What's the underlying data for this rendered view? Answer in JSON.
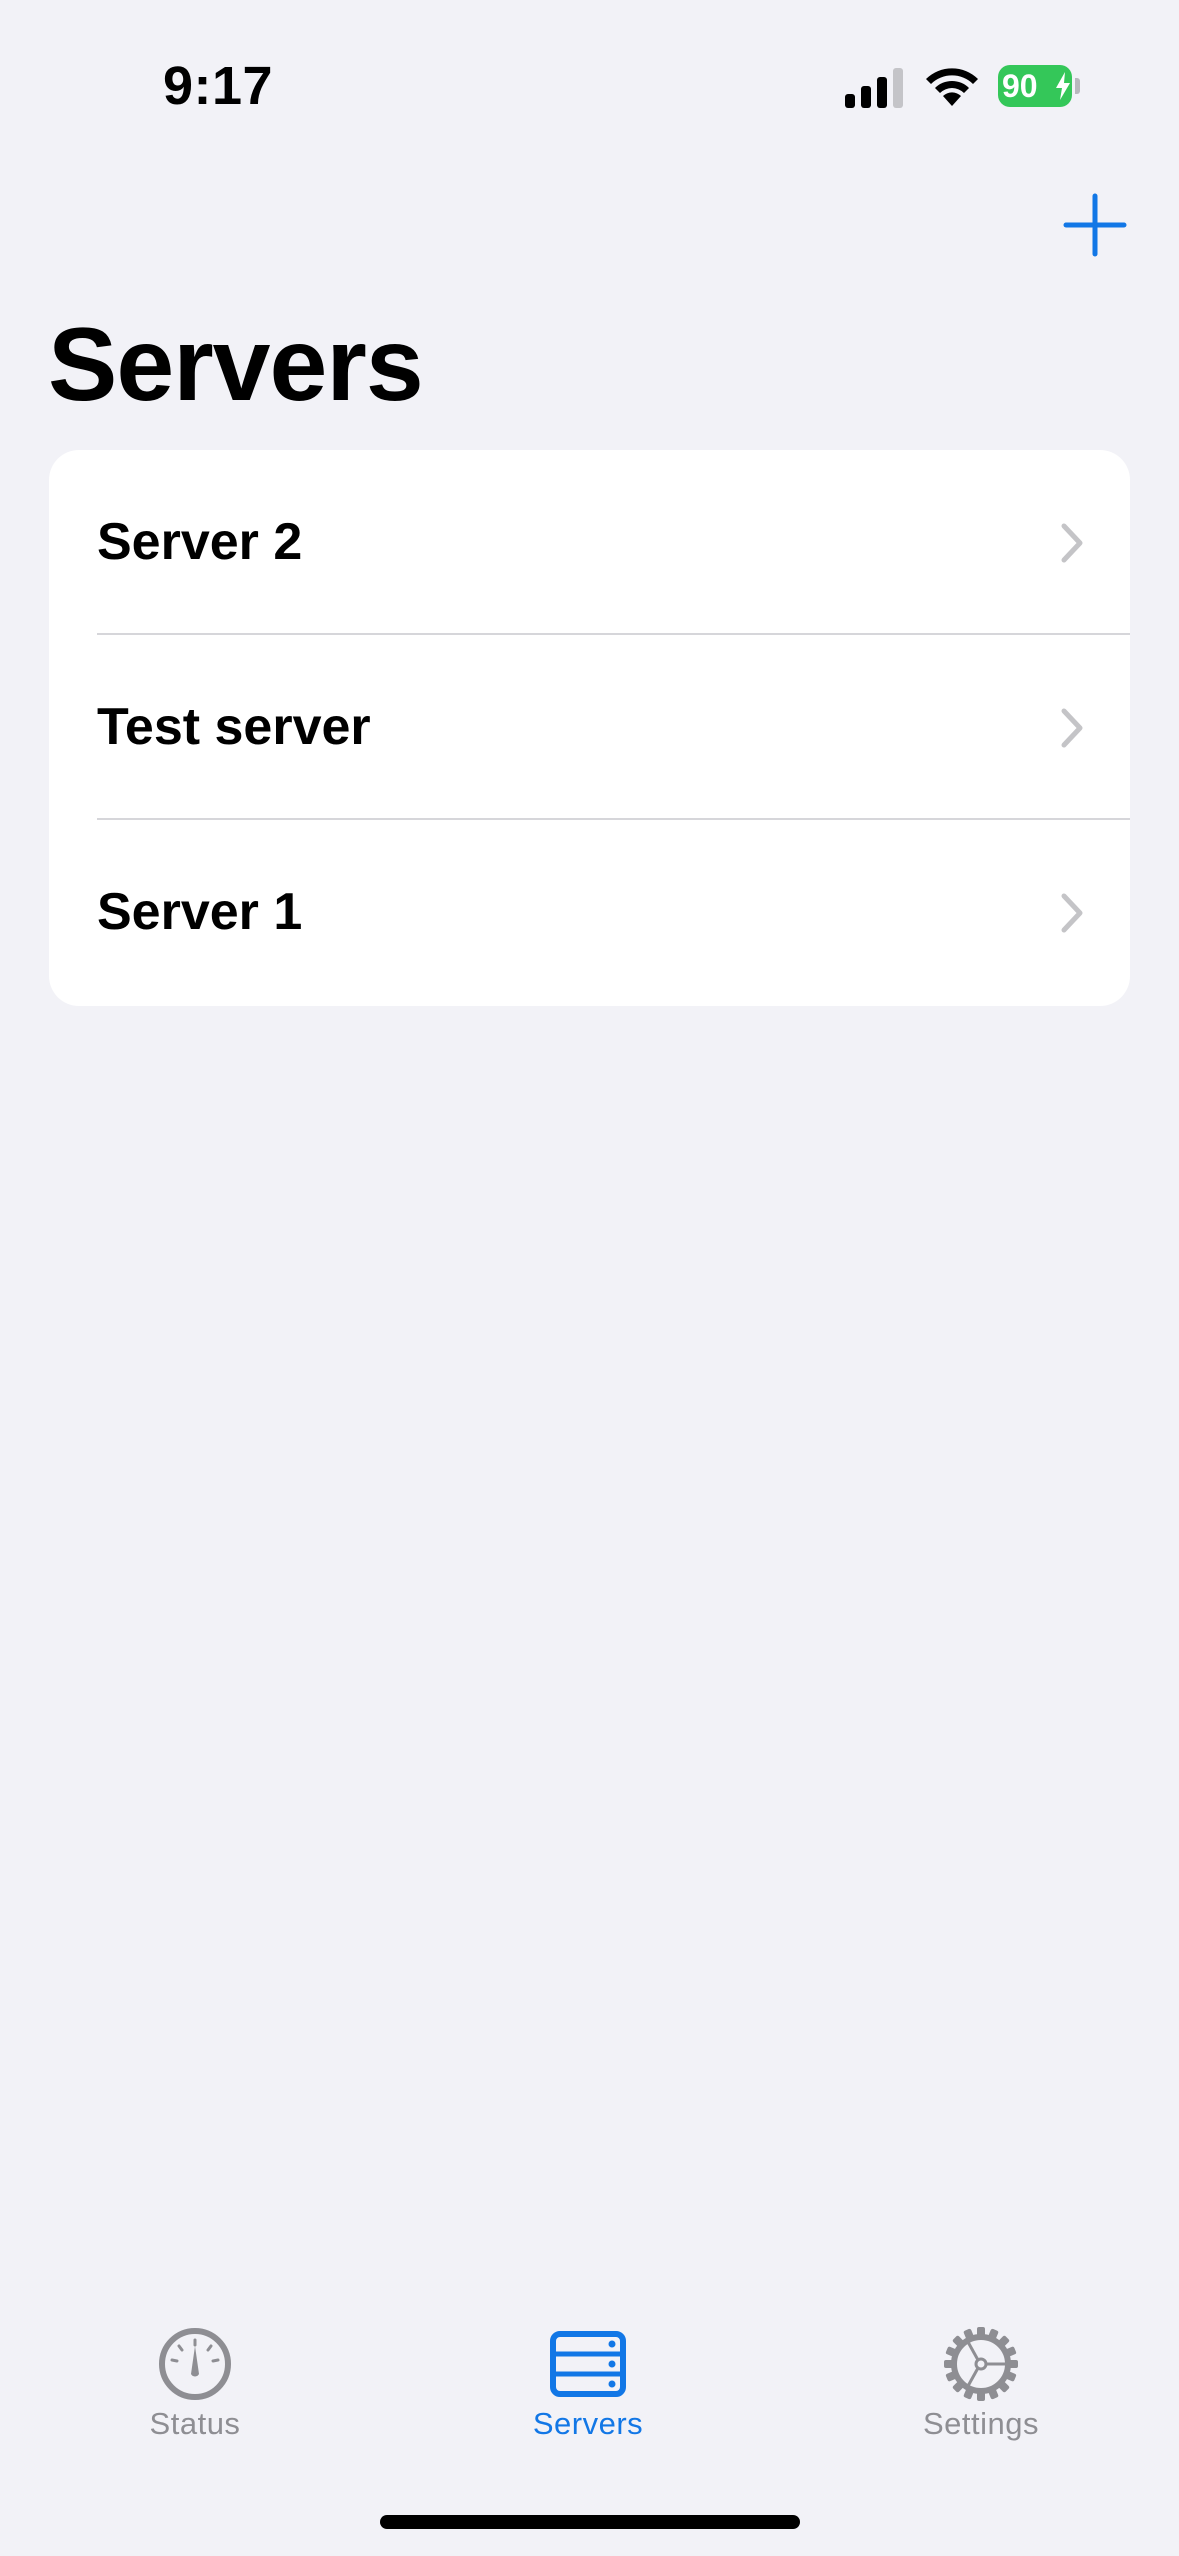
{
  "status_bar": {
    "time": "9:17",
    "battery_level": "90",
    "signal_bars_active": 3,
    "signal_bars_total": 4,
    "icons": [
      "signal-icon",
      "wifi-icon",
      "battery-icon",
      "charging-bolt-icon"
    ]
  },
  "nav": {
    "add_icon": "plus-icon",
    "title": "Servers"
  },
  "servers": {
    "items": [
      {
        "label": "Server 2"
      },
      {
        "label": "Test server"
      },
      {
        "label": "Server 1"
      }
    ]
  },
  "tab_bar": {
    "selected": "Servers",
    "tabs": [
      {
        "label": "Status",
        "icon": "gauge-icon"
      },
      {
        "label": "Servers",
        "icon": "server-rack-icon"
      },
      {
        "label": "Settings",
        "icon": "gear-icon"
      }
    ]
  },
  "colors": {
    "accent": "#1277e6",
    "background": "#f2f2f7",
    "card": "#ffffff",
    "inactive": "#8e8e93",
    "battery": "#34c759"
  }
}
